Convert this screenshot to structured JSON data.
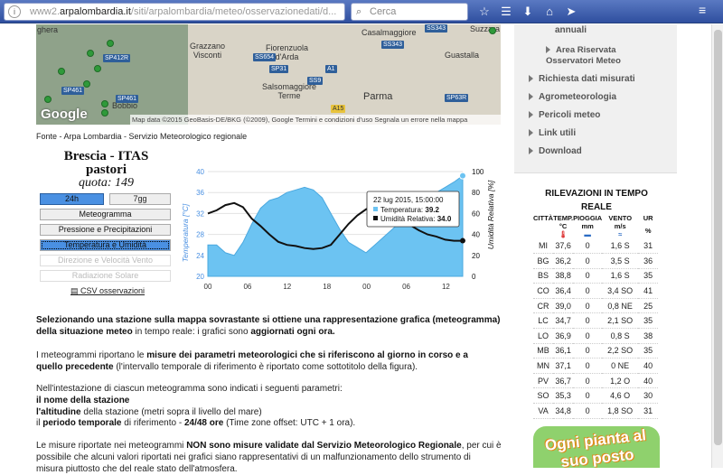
{
  "browser": {
    "url_prefix": "www2.",
    "url_host": "arpalombardia.it",
    "url_path": "/siti/arpalombardia/meteo/osservazionedati/d...",
    "search_placeholder": "Cerca"
  },
  "map": {
    "labels": [
      "ghera",
      "Grazzano\nVisconti",
      "Fiorenzuola\nd'Arda",
      "Casalmaggiore",
      "Suzzara",
      "Guastalla",
      "Salsomaggiore\nTerme",
      "Parma",
      "Bobbio"
    ],
    "roads": [
      "SS343",
      "SP412R",
      "SP461",
      "SP461",
      "SS654",
      "SP31",
      "A1",
      "SS9",
      "A15",
      "SP63R",
      "SS343"
    ],
    "google": "Google",
    "attribution": "Map data ©2015 GeoBasis-DE/BKG (©2009), Google   Termini e condizioni d'uso   Segnala un errore nella mappa"
  },
  "source": "Fonte - Arpa Lombardia - Servizio Meteorologico regionale",
  "station": {
    "name_line1": "Brescia - ITAS",
    "name_line2": "pastori",
    "quota_label": "quota:",
    "quota_value": "149"
  },
  "buttons": {
    "b24": "24h",
    "b7": "7gg",
    "meteogramma": "Meteogramma",
    "pressione": "Pressione e Precipitazioni",
    "temperatura": "Temperatura e Umidità",
    "vento": "Direzione e Velocità Vento",
    "radiazione": "Radiazione Solare",
    "csv": "CSV osservazioni"
  },
  "chart_data": {
    "type": "area",
    "xlabels": [
      "00",
      "06",
      "12",
      "18",
      "00",
      "06",
      "12"
    ],
    "y_left_label": "Temperatura [°C]",
    "y_left_ticks": [
      20,
      24,
      28,
      32,
      36,
      40
    ],
    "y_right_label": "Umidità Relativa [%]",
    "y_right_ticks": [
      0,
      20,
      40,
      60,
      80,
      100
    ],
    "temperature": [
      26,
      26,
      24.5,
      24,
      26.5,
      30,
      33,
      34.5,
      35,
      36,
      36.5,
      37,
      36.5,
      35,
      32,
      29,
      26.5,
      25.5,
      24.5,
      26,
      27.5,
      29,
      30.5,
      32.5,
      33.5,
      35,
      36,
      37,
      38,
      39.2
    ],
    "humidity": [
      60,
      63,
      68,
      70,
      66,
      55,
      48,
      40,
      33,
      30,
      29,
      27,
      26,
      27,
      30,
      40,
      50,
      58,
      64,
      68,
      67,
      62,
      55,
      49,
      44,
      40,
      38,
      35,
      34,
      34
    ],
    "tooltip": {
      "title": "22 lug 2015, 15:00:00",
      "temp_label": "Temperatura:",
      "temp_value": "39.2",
      "hum_label": "Umidità Relativa:",
      "hum_value": "34.0"
    }
  },
  "paragraphs": {
    "p1a": "Selezionando una stazione sulla mappa sovrastante si ottiene una rappresentazione grafica (meteogramma)",
    "p1b": "della situazione meteo",
    "p1c": " in tempo reale: i grafici sono ",
    "p1d": "aggiornati ogni ora.",
    "p2a": "I meteogrammi riportano le ",
    "p2b": "misure dei parametri meteorologici che si riferiscono al giorno in corso e a",
    "p2c": "quello precedente",
    "p2d": " (l'intervallo temporale di riferimento è riportato come sottotitolo della figura).",
    "p3a": "Nell'intestazione di ciascun meteogramma sono indicati i seguenti parametri:",
    "p3b": "il nome della stazione",
    "p3c": "l'altitudine",
    "p3d": " della stazione (metri sopra il livello del mare)",
    "p3e": "il ",
    "p3f": "periodo temporale",
    "p3g": " di riferimento  - ",
    "p3h": "24/48 ore",
    "p3i": " (Time zone offset: UTC + 1 ora).",
    "p4a": "Le misure riportate nei meteogrammi ",
    "p4b": "NON sono misure validate dal Servizio Meteorologico Regionale",
    "p4c": ", per cui è",
    "p4d": "possibile che alcuni valori riportati nei grafici siano rappresentativi di un malfunzionamento dello strumento di",
    "p4e": "misura piuttosto che del reale stato dell'atmosfera."
  },
  "sidebar": {
    "annuali": "annuali",
    "riservata": "Area Riservata\nOsservatori Meteo",
    "links": [
      "Richiesta dati misurati",
      "Agrometeorologia",
      "Pericoli meteo",
      "Link utili",
      "Download"
    ]
  },
  "realtime": {
    "title": "RILEVAZIONI IN TEMPO REALE",
    "headers": [
      "CITTÀ",
      "TEMP.",
      "PIOGGIA",
      "VENTO",
      "UR"
    ],
    "units": [
      "",
      "°C",
      "mm",
      "m/s",
      "%"
    ],
    "rows": [
      [
        "MI",
        "37,6",
        "0",
        "1,6 S",
        "31"
      ],
      [
        "BG",
        "36,2",
        "0",
        "3,5 S",
        "36"
      ],
      [
        "BS",
        "38,8",
        "0",
        "1,6 S",
        "35"
      ],
      [
        "CO",
        "36,4",
        "0",
        "3,4 SO",
        "41"
      ],
      [
        "CR",
        "39,0",
        "0",
        "0,8 NE",
        "25"
      ],
      [
        "LC",
        "34,7",
        "0",
        "2,1 SO",
        "35"
      ],
      [
        "LO",
        "36,9",
        "0",
        "0,8 S",
        "38"
      ],
      [
        "MB",
        "36,1",
        "0",
        "2,2 SO",
        "35"
      ],
      [
        "MN",
        "37,1",
        "0",
        "0 NE",
        "40"
      ],
      [
        "PV",
        "36,7",
        "0",
        "1,2 O",
        "40"
      ],
      [
        "SO",
        "35,3",
        "0",
        "4,6 O",
        "30"
      ],
      [
        "VA",
        "34,8",
        "0",
        "1,8 SO",
        "31"
      ]
    ]
  },
  "banner": "Ogni pianta al suo posto"
}
